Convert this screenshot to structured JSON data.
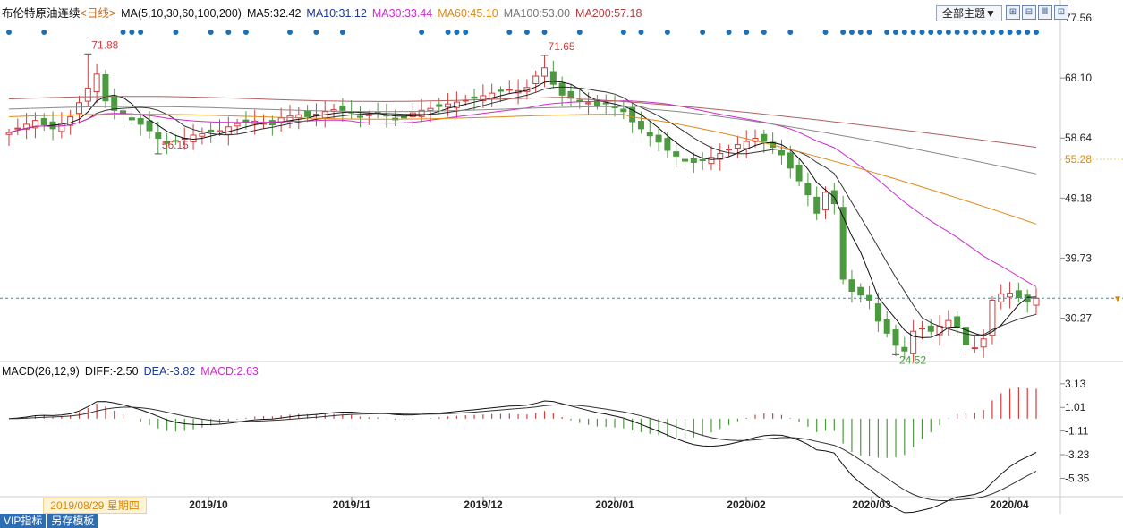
{
  "header": {
    "symbol": "布伦特原油连续",
    "period": "<日线>",
    "ma_label": "MA(5,10,30,60,100,200)",
    "ma5": "MA5:32.42",
    "ma10": "MA10:31.12",
    "ma30": "MA30:33.44",
    "ma60": "MA60:45.10",
    "ma100": "MA100:53.00",
    "ma200": "MA200:57.18",
    "theme_button": "全部主题▼"
  },
  "macd_header": {
    "label": "MACD(26,12,9)",
    "diff": "DIFF:-2.50",
    "dea": "DEA:-3.82",
    "macd": "MACD:2.63"
  },
  "colors": {
    "up": "#d23c3c",
    "down": "#4c9a3f",
    "ma5": "#111111",
    "ma10": "#333333",
    "ma30": "#cc2ecc",
    "ma60": "#e0891a",
    "ma100": "#8a8a8a",
    "ma200": "#b06060",
    "dots": "#1f6fb5",
    "current_line": "#2a8fc0"
  },
  "footer": {
    "date_tag": "2019/08/29 星期四",
    "tab_vip": "VIP指标",
    "tab_save": "另存模板"
  },
  "chart_data": [
    {
      "type": "candlestick",
      "title": "布伦特原油连续",
      "y_ticks": [
        77.56,
        68.1,
        58.64,
        49.18,
        39.73,
        30.27
      ],
      "current_price_label": "55.28",
      "ylim": [
        24.0,
        77.56
      ],
      "x_ticks": [
        "2019/10",
        "2019/11",
        "2019/12",
        "2020/01",
        "2020/02",
        "2020/03",
        "2020/04"
      ],
      "annotations": [
        {
          "text": "71.88",
          "value": 71.88,
          "date": "2019/09/16"
        },
        {
          "text": "56.15",
          "value": 56.15,
          "date": "2019/10/03"
        },
        {
          "text": "71.65",
          "value": 71.65,
          "date": "2020/01/08"
        },
        {
          "text": "24.52",
          "value": 24.52,
          "date": "2020/03/30"
        }
      ],
      "close_approx": [
        59.5,
        60.2,
        60.8,
        61.4,
        60.7,
        60.1,
        61.0,
        62.0,
        64.2,
        66.5,
        68.7,
        64.5,
        63.0,
        62.4,
        61.5,
        60.8,
        59.8,
        58.6,
        57.8,
        58.2,
        58.6,
        59.1,
        59.3,
        59.6,
        59.8,
        60.4,
        60.9,
        61.2,
        61.3,
        61.0,
        60.7,
        61.8,
        62.1,
        62.3,
        62.0,
        62.4,
        62.8,
        63.1,
        63.0,
        62.6,
        61.9,
        62.3,
        62.7,
        62.1,
        61.5,
        61.8,
        62.6,
        63.0,
        63.3,
        63.6,
        64.0,
        64.3,
        64.6,
        64.9,
        65.3,
        65.7,
        66.0,
        66.3,
        66.1,
        66.6,
        68.4,
        69.7,
        67.1,
        65.4,
        64.9,
        64.5,
        64.2,
        63.8,
        64.1,
        63.4,
        62.8,
        61.2,
        60.1,
        59.0,
        58.0,
        56.7,
        55.8,
        55.0,
        54.8,
        55.1,
        55.6,
        56.2,
        56.9,
        57.6,
        58.1,
        58.6,
        58.1,
        57.2,
        56.0,
        53.9,
        51.9,
        49.7,
        46.8,
        50.1,
        48.3,
        36.4,
        34.5,
        33.9,
        33.1,
        29.8,
        27.9,
        26.0,
        25.1,
        28.2,
        28.7,
        28.2,
        29.0,
        29.9,
        28.8,
        26.1,
        25.6,
        27.0,
        33.1,
        34.1,
        34.2,
        33.5,
        32.8,
        33.4
      ],
      "series": [
        {
          "name": "MA5",
          "last": 32.42
        },
        {
          "name": "MA10",
          "last": 31.12
        },
        {
          "name": "MA30",
          "last": 33.44
        },
        {
          "name": "MA60",
          "last": 45.1
        },
        {
          "name": "MA100",
          "last": 53.0
        },
        {
          "name": "MA200",
          "last": 57.18
        }
      ]
    },
    {
      "type": "bar+line",
      "title": "MACD(26,12,9)",
      "y_ticks": [
        3.13,
        1.01,
        -1.11,
        -3.23,
        -5.35
      ],
      "ylim": [
        -7.0,
        4.0
      ],
      "diff_last": -2.5,
      "dea_last": -3.82,
      "macd_last": 2.63
    }
  ]
}
